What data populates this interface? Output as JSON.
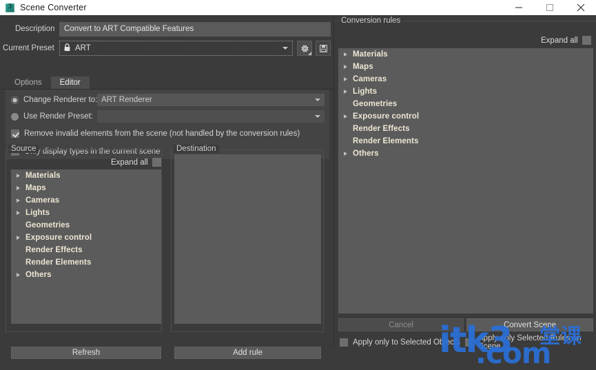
{
  "window": {
    "title": "Scene Converter",
    "icon": "max3-app-icon",
    "controls": {
      "minimize": "minimize-icon",
      "maximize": "maximize-icon",
      "close": "close-icon"
    }
  },
  "form": {
    "description_label": "Description",
    "description_value": "Convert to ART Compatible Features",
    "preset_label": "Current Preset",
    "preset_value": "ART",
    "preset_lock_icon": "lock-icon",
    "gear_button": "gear-icon",
    "save_button": "save-disk-icon"
  },
  "tabs": [
    {
      "label": "Options",
      "active": false
    },
    {
      "label": "Editor",
      "active": true
    }
  ],
  "options": {
    "change_renderer_label": "Change Renderer to:",
    "change_renderer_value": "ART Renderer",
    "change_renderer_selected": true,
    "use_preset_label": "Use Render Preset:",
    "use_preset_value": "",
    "use_preset_selected": false,
    "remove_invalid_label": "Remove invalid elements from the scene (not handled by the conversion rules)",
    "remove_invalid_checked": true,
    "only_display_label": "Only display types in the current scene",
    "only_display_checked": false
  },
  "source": {
    "title": "Source",
    "expand_all_label": "Expand all",
    "expand_all_checked": false,
    "refresh_label": "Refresh",
    "items": [
      {
        "label": "Materials",
        "expandable": true
      },
      {
        "label": "Maps",
        "expandable": true
      },
      {
        "label": "Cameras",
        "expandable": true
      },
      {
        "label": "Lights",
        "expandable": true
      },
      {
        "label": "Geometries",
        "expandable": false
      },
      {
        "label": "Exposure control",
        "expandable": true
      },
      {
        "label": "Render Effects",
        "expandable": false
      },
      {
        "label": "Render Elements",
        "expandable": false
      },
      {
        "label": "Others",
        "expandable": true
      }
    ]
  },
  "destination": {
    "title": "Destination",
    "add_rule_label": "Add rule",
    "items": []
  },
  "conversion_rules": {
    "title": "Conversion rules",
    "expand_all_label": "Expand all",
    "expand_all_checked": false,
    "items": [
      {
        "label": "Materials",
        "expandable": true
      },
      {
        "label": "Maps",
        "expandable": true
      },
      {
        "label": "Cameras",
        "expandable": true
      },
      {
        "label": "Lights",
        "expandable": true
      },
      {
        "label": "Geometries",
        "expandable": false
      },
      {
        "label": "Exposure control",
        "expandable": true
      },
      {
        "label": "Render Effects",
        "expandable": false
      },
      {
        "label": "Render Elements",
        "expandable": false
      },
      {
        "label": "Others",
        "expandable": true
      }
    ]
  },
  "footer": {
    "cancel_label": "Cancel",
    "convert_label": "Convert Scene",
    "apply_selected_objects_label": "Apply only to Selected Objects",
    "apply_selected_objects_checked": false,
    "apply_selected_rules_label": "Apply only Selected Rules on Scene",
    "apply_selected_rules_checked": false
  },
  "watermark": {
    "text_main": "itk3",
    "text_domain": ".com",
    "text_cn": "堂课",
    "color": "#2a6fd6"
  }
}
